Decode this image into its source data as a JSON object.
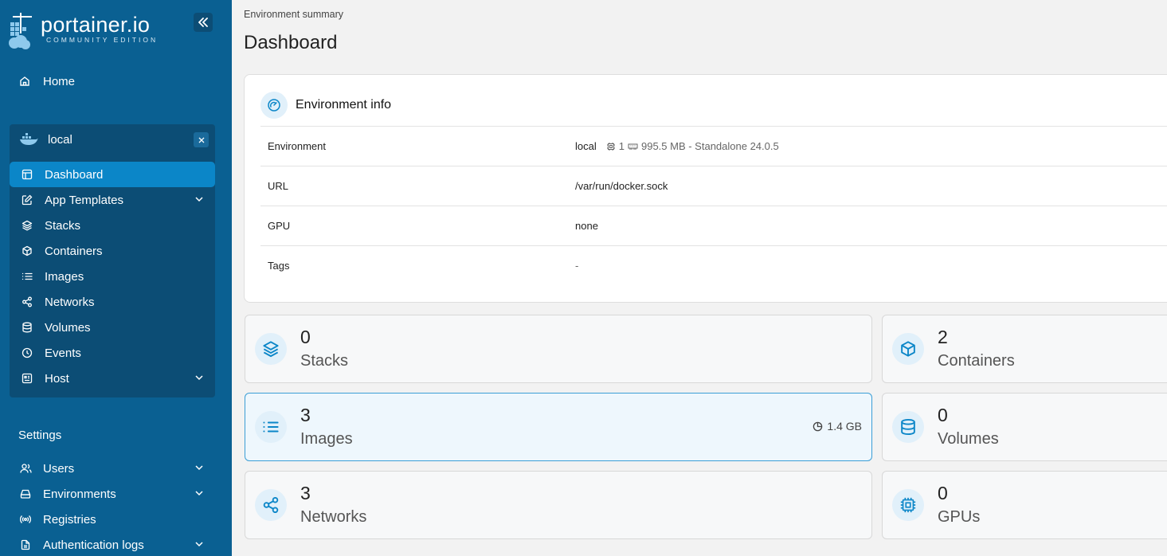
{
  "brand": {
    "name": "portainer.io",
    "edition": "COMMUNITY EDITION"
  },
  "nav": {
    "home": "Home"
  },
  "environment": {
    "name": "local",
    "items": [
      {
        "label": "Dashboard",
        "icon": "dashboard-icon",
        "active": true
      },
      {
        "label": "App Templates",
        "icon": "edit-icon",
        "expandable": true
      },
      {
        "label": "Stacks",
        "icon": "layers-icon"
      },
      {
        "label": "Containers",
        "icon": "box-icon"
      },
      {
        "label": "Images",
        "icon": "list-icon"
      },
      {
        "label": "Networks",
        "icon": "share-icon"
      },
      {
        "label": "Volumes",
        "icon": "database-icon"
      },
      {
        "label": "Events",
        "icon": "clock-icon"
      },
      {
        "label": "Host",
        "icon": "host-icon",
        "expandable": true
      }
    ]
  },
  "settings": {
    "label": "Settings",
    "items": [
      {
        "label": "Users",
        "icon": "users-icon",
        "expandable": true
      },
      {
        "label": "Environments",
        "icon": "hard-drive-icon",
        "expandable": true
      },
      {
        "label": "Registries",
        "icon": "radio-icon"
      },
      {
        "label": "Authentication logs",
        "icon": "file-icon",
        "expandable": true
      }
    ]
  },
  "main": {
    "breadcrumb": "Environment summary",
    "title": "Dashboard",
    "env_info": {
      "title": "Environment info",
      "rows": [
        {
          "key": "Environment",
          "value": "local",
          "cpu": "1",
          "memory": "995.5 MB - Standalone 24.0.5"
        },
        {
          "key": "URL",
          "value": "/var/run/docker.sock"
        },
        {
          "key": "GPU",
          "value": "none"
        },
        {
          "key": "Tags",
          "value": "-"
        }
      ]
    },
    "tiles": [
      {
        "count": "0",
        "label": "Stacks",
        "icon": "layers-icon"
      },
      {
        "count": "2",
        "label": "Containers",
        "icon": "box-icon"
      },
      {
        "count": "3",
        "label": "Images",
        "icon": "list-icon",
        "size": "1.4 GB"
      },
      {
        "count": "0",
        "label": "Volumes",
        "icon": "database-icon"
      },
      {
        "count": "3",
        "label": "Networks",
        "icon": "share-icon"
      },
      {
        "count": "0",
        "label": "GPUs",
        "icon": "cpu-icon"
      }
    ]
  },
  "colors": {
    "sidebar": "#0a6092",
    "active_item": "#0b86c8",
    "accent": "#0b86c8"
  }
}
